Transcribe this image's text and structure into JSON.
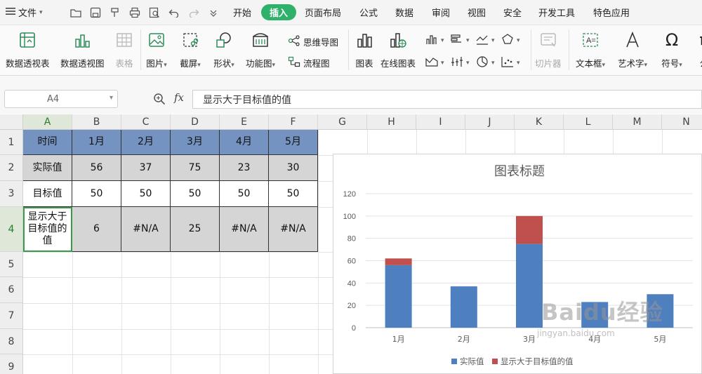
{
  "menubar": {
    "file_label": "文件",
    "tabs": [
      "开始",
      "插入",
      "页面布局",
      "公式",
      "数据",
      "审阅",
      "视图",
      "安全",
      "开发工具",
      "特色应用"
    ],
    "active_tab": "插入"
  },
  "ribbon": {
    "pivot_table": "数据透视表",
    "pivot_chart": "数据透视图",
    "table": "表格",
    "picture": "图片",
    "screenshot": "截屏",
    "shapes": "形状",
    "function_chart": "功能图",
    "mindmap": "思维导图",
    "flowchart": "流程图",
    "chart": "图表",
    "online_chart": "在线图表",
    "slicer": "切片器",
    "textbox": "文本框",
    "wordart": "艺术字",
    "symbol": "符号",
    "formula_partial": "公"
  },
  "formula_bar": {
    "name_box": "A4",
    "fx": "fx",
    "content": "显示大于目标值的值"
  },
  "grid": {
    "columns": [
      "A",
      "B",
      "C",
      "D",
      "E",
      "F",
      "G",
      "H",
      "I",
      "J",
      "K",
      "L",
      "M",
      "N"
    ],
    "rows": [
      "1",
      "2",
      "3",
      "4",
      "5",
      "6",
      "7",
      "8",
      "9"
    ],
    "table": [
      [
        "时间",
        "1月",
        "2月",
        "3月",
        "4月",
        "5月"
      ],
      [
        "实际值",
        "56",
        "37",
        "75",
        "23",
        "30"
      ],
      [
        "目标值",
        "50",
        "50",
        "50",
        "50",
        "50"
      ],
      [
        "显示大于目标值的值",
        "6",
        "#N/A",
        "25",
        "#N/A",
        "#N/A"
      ]
    ]
  },
  "chart_data": {
    "type": "bar",
    "stacked": true,
    "title": "图表标题",
    "categories": [
      "1月",
      "2月",
      "3月",
      "4月",
      "5月"
    ],
    "series": [
      {
        "name": "实际值",
        "values": [
          56,
          37,
          75,
          23,
          30
        ],
        "color": "#4e7fbf"
      },
      {
        "name": "显示大于目标值的值",
        "values": [
          6,
          null,
          25,
          null,
          null
        ],
        "color": "#c0504d"
      }
    ],
    "ylim": [
      0,
      120
    ],
    "yticks": [
      0,
      20,
      40,
      60,
      80,
      100,
      120
    ],
    "grid": true,
    "legend": "bottom"
  },
  "watermark": {
    "text": "Baidu经验",
    "sub": "jingyan.baidu.com"
  },
  "colors": {
    "accent": "#2fb16c",
    "header_fill": "#7593c0",
    "gray_fill": "#d5d5d5"
  }
}
